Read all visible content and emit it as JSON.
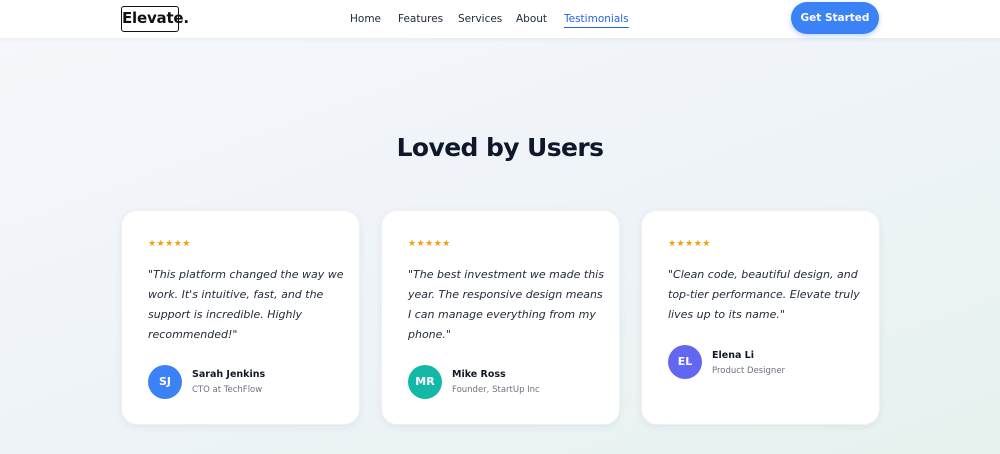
{
  "brand": {
    "logo": "Elevate."
  },
  "nav": {
    "items": [
      {
        "label": "Home"
      },
      {
        "label": "Features"
      },
      {
        "label": "Services"
      },
      {
        "label": "About"
      },
      {
        "label": "Testimonials",
        "active": true
      }
    ],
    "cta_label": "Get Started"
  },
  "section": {
    "title": "Loved by Users"
  },
  "testimonials": [
    {
      "rating": "★★★★★",
      "quote": "\"This platform changed the way we work. It's intuitive, fast, and the support is incredible. Highly recommended!\"",
      "initials": "SJ",
      "name": "Sarah Jenkins",
      "role": "CTO at TechFlow",
      "avatar_color": "#3b82f6"
    },
    {
      "rating": "★★★★★",
      "quote": "\"The best investment we made this year. The responsive design means I can manage everything from my phone.\"",
      "initials": "MR",
      "name": "Mike Ross",
      "role": "Founder, StartUp Inc",
      "avatar_color": "#14b8a6"
    },
    {
      "rating": "★★★★★",
      "quote": "\"Clean code, beautiful design, and top-tier performance. Elevate truly lives up to its name.\"",
      "initials": "EL",
      "name": "Elena Li",
      "role": "Product Designer",
      "avatar_color": "#6366f1"
    }
  ],
  "colors": {
    "accent": "#3b82f6",
    "star": "#f59e0b"
  }
}
